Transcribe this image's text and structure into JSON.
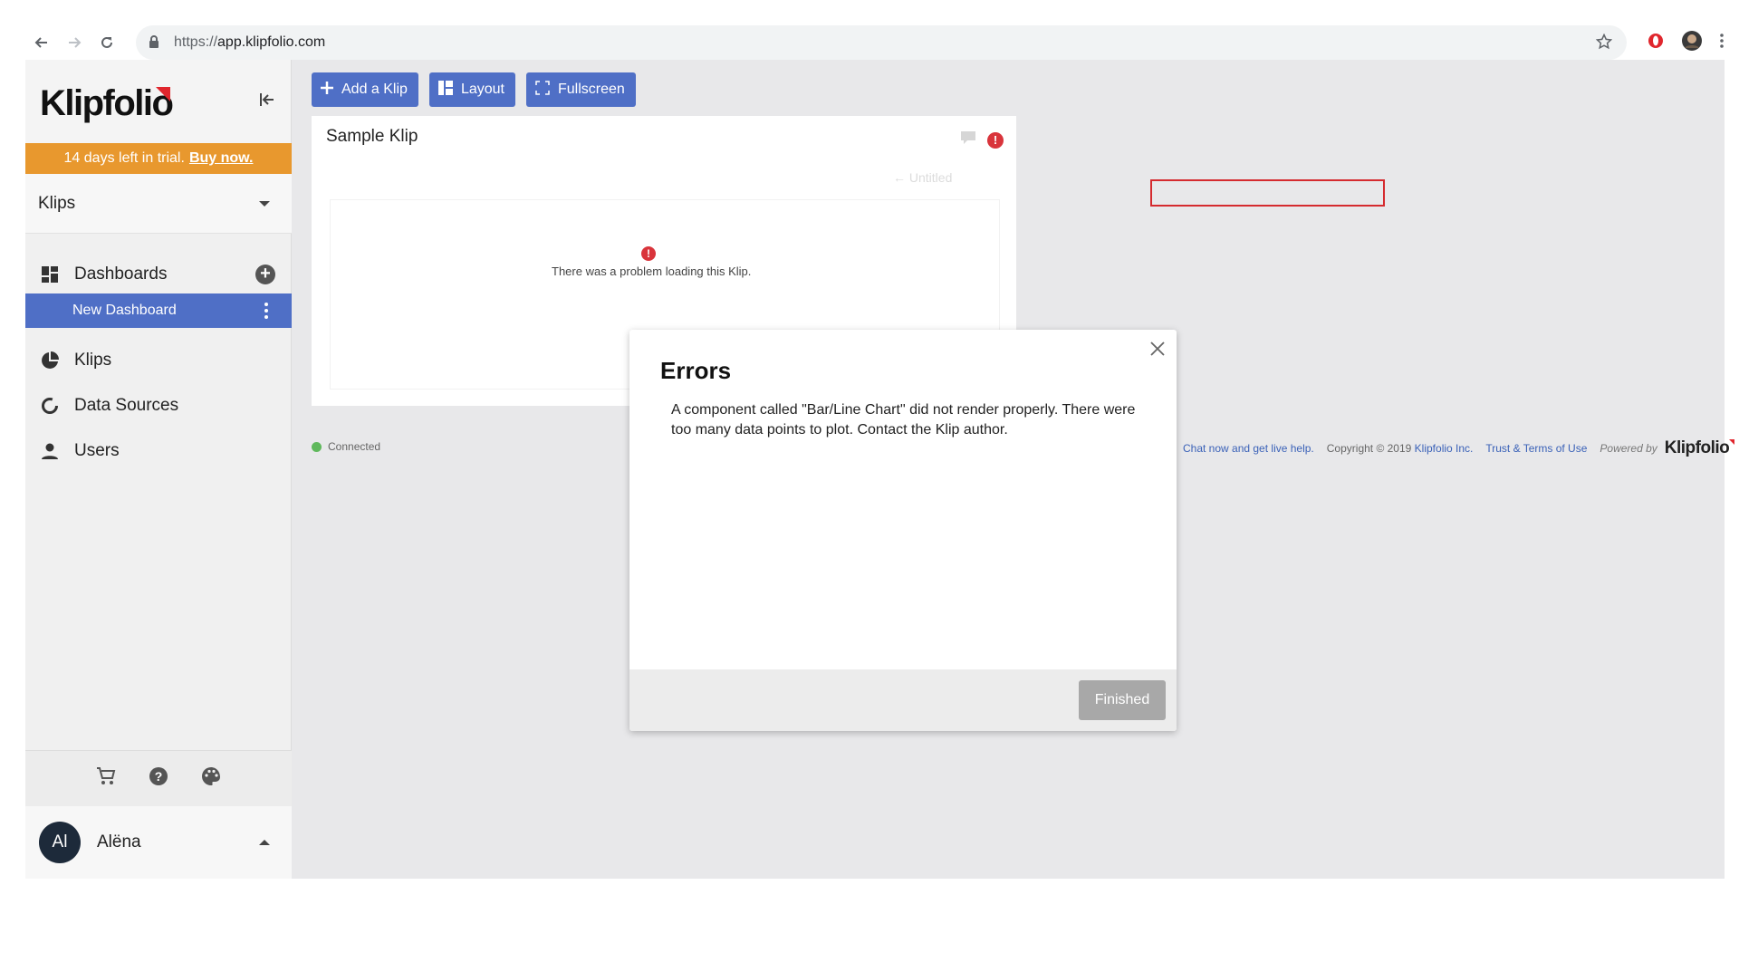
{
  "browser": {
    "url_protocol": "https://",
    "url_host": "app.klipfolio.com"
  },
  "sidebar": {
    "logo": "Klipfolio",
    "trial_text": "14 days left in trial.",
    "trial_link": "Buy now.",
    "section_select": "Klips",
    "nav": {
      "dashboards": "Dashboards",
      "new_dashboard": "New Dashboard",
      "klips": "Klips",
      "data_sources": "Data Sources",
      "users": "Users"
    },
    "user": {
      "initials": "Al",
      "name": "Alëna"
    }
  },
  "toolbar": {
    "add_klip": "Add a Klip",
    "layout": "Layout",
    "fullscreen": "Fullscreen"
  },
  "klip": {
    "title": "Sample Klip",
    "subtitle": "← Untitled",
    "error_text": "There was a problem loading this Klip."
  },
  "status": {
    "connection": "Connected"
  },
  "footer": {
    "chat": "Chat now and get live help.",
    "copyright": "Copyright © 2019",
    "company": "Klipfolio Inc.",
    "terms": "Trust & Terms of Use",
    "powered_by": "Powered by",
    "powered_logo": "Klipfolio"
  },
  "modal": {
    "title": "Errors",
    "message": "A component called \"Bar/Line Chart\" did not render properly. There were too many data points to plot. Contact the Klip author.",
    "finished_button": "Finished"
  },
  "colors": {
    "accent_blue": "#4f6fc6",
    "trial_orange": "#e8982e",
    "error_red": "#d9343b",
    "connected_green": "#5fb85c"
  }
}
